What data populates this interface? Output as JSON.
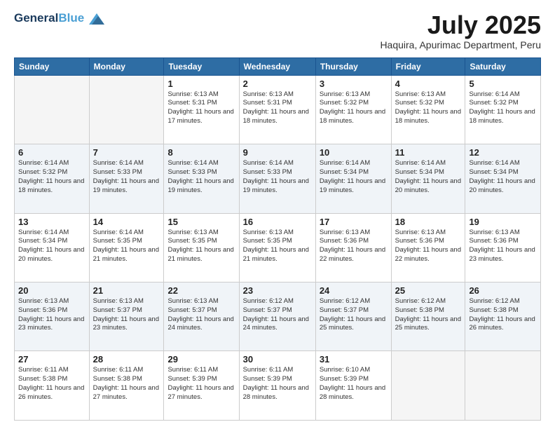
{
  "header": {
    "logo_general": "General",
    "logo_blue": "Blue",
    "month_title": "July 2025",
    "location": "Haquira, Apurimac Department, Peru"
  },
  "weekdays": [
    "Sunday",
    "Monday",
    "Tuesday",
    "Wednesday",
    "Thursday",
    "Friday",
    "Saturday"
  ],
  "weeks": [
    [
      {
        "day": "",
        "info": ""
      },
      {
        "day": "",
        "info": ""
      },
      {
        "day": "1",
        "info": "Sunrise: 6:13 AM\nSunset: 5:31 PM\nDaylight: 11 hours and 17 minutes."
      },
      {
        "day": "2",
        "info": "Sunrise: 6:13 AM\nSunset: 5:31 PM\nDaylight: 11 hours and 18 minutes."
      },
      {
        "day": "3",
        "info": "Sunrise: 6:13 AM\nSunset: 5:32 PM\nDaylight: 11 hours and 18 minutes."
      },
      {
        "day": "4",
        "info": "Sunrise: 6:13 AM\nSunset: 5:32 PM\nDaylight: 11 hours and 18 minutes."
      },
      {
        "day": "5",
        "info": "Sunrise: 6:14 AM\nSunset: 5:32 PM\nDaylight: 11 hours and 18 minutes."
      }
    ],
    [
      {
        "day": "6",
        "info": "Sunrise: 6:14 AM\nSunset: 5:32 PM\nDaylight: 11 hours and 18 minutes."
      },
      {
        "day": "7",
        "info": "Sunrise: 6:14 AM\nSunset: 5:33 PM\nDaylight: 11 hours and 19 minutes."
      },
      {
        "day": "8",
        "info": "Sunrise: 6:14 AM\nSunset: 5:33 PM\nDaylight: 11 hours and 19 minutes."
      },
      {
        "day": "9",
        "info": "Sunrise: 6:14 AM\nSunset: 5:33 PM\nDaylight: 11 hours and 19 minutes."
      },
      {
        "day": "10",
        "info": "Sunrise: 6:14 AM\nSunset: 5:34 PM\nDaylight: 11 hours and 19 minutes."
      },
      {
        "day": "11",
        "info": "Sunrise: 6:14 AM\nSunset: 5:34 PM\nDaylight: 11 hours and 20 minutes."
      },
      {
        "day": "12",
        "info": "Sunrise: 6:14 AM\nSunset: 5:34 PM\nDaylight: 11 hours and 20 minutes."
      }
    ],
    [
      {
        "day": "13",
        "info": "Sunrise: 6:14 AM\nSunset: 5:34 PM\nDaylight: 11 hours and 20 minutes."
      },
      {
        "day": "14",
        "info": "Sunrise: 6:14 AM\nSunset: 5:35 PM\nDaylight: 11 hours and 21 minutes."
      },
      {
        "day": "15",
        "info": "Sunrise: 6:13 AM\nSunset: 5:35 PM\nDaylight: 11 hours and 21 minutes."
      },
      {
        "day": "16",
        "info": "Sunrise: 6:13 AM\nSunset: 5:35 PM\nDaylight: 11 hours and 21 minutes."
      },
      {
        "day": "17",
        "info": "Sunrise: 6:13 AM\nSunset: 5:36 PM\nDaylight: 11 hours and 22 minutes."
      },
      {
        "day": "18",
        "info": "Sunrise: 6:13 AM\nSunset: 5:36 PM\nDaylight: 11 hours and 22 minutes."
      },
      {
        "day": "19",
        "info": "Sunrise: 6:13 AM\nSunset: 5:36 PM\nDaylight: 11 hours and 23 minutes."
      }
    ],
    [
      {
        "day": "20",
        "info": "Sunrise: 6:13 AM\nSunset: 5:36 PM\nDaylight: 11 hours and 23 minutes."
      },
      {
        "day": "21",
        "info": "Sunrise: 6:13 AM\nSunset: 5:37 PM\nDaylight: 11 hours and 23 minutes."
      },
      {
        "day": "22",
        "info": "Sunrise: 6:13 AM\nSunset: 5:37 PM\nDaylight: 11 hours and 24 minutes."
      },
      {
        "day": "23",
        "info": "Sunrise: 6:12 AM\nSunset: 5:37 PM\nDaylight: 11 hours and 24 minutes."
      },
      {
        "day": "24",
        "info": "Sunrise: 6:12 AM\nSunset: 5:37 PM\nDaylight: 11 hours and 25 minutes."
      },
      {
        "day": "25",
        "info": "Sunrise: 6:12 AM\nSunset: 5:38 PM\nDaylight: 11 hours and 25 minutes."
      },
      {
        "day": "26",
        "info": "Sunrise: 6:12 AM\nSunset: 5:38 PM\nDaylight: 11 hours and 26 minutes."
      }
    ],
    [
      {
        "day": "27",
        "info": "Sunrise: 6:11 AM\nSunset: 5:38 PM\nDaylight: 11 hours and 26 minutes."
      },
      {
        "day": "28",
        "info": "Sunrise: 6:11 AM\nSunset: 5:38 PM\nDaylight: 11 hours and 27 minutes."
      },
      {
        "day": "29",
        "info": "Sunrise: 6:11 AM\nSunset: 5:39 PM\nDaylight: 11 hours and 27 minutes."
      },
      {
        "day": "30",
        "info": "Sunrise: 6:11 AM\nSunset: 5:39 PM\nDaylight: 11 hours and 28 minutes."
      },
      {
        "day": "31",
        "info": "Sunrise: 6:10 AM\nSunset: 5:39 PM\nDaylight: 11 hours and 28 minutes."
      },
      {
        "day": "",
        "info": ""
      },
      {
        "day": "",
        "info": ""
      }
    ]
  ]
}
